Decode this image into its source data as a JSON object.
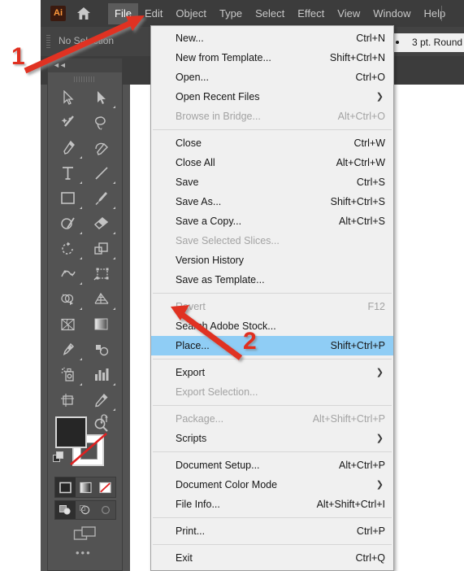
{
  "app": {
    "name": "Adobe Illustrator",
    "logo_text": "Ai",
    "home_icon": "home-icon"
  },
  "menubar": {
    "items": [
      {
        "label": "File",
        "active": true
      },
      {
        "label": "Edit",
        "active": false
      },
      {
        "label": "Object",
        "active": false
      },
      {
        "label": "Type",
        "active": false
      },
      {
        "label": "Select",
        "active": false
      },
      {
        "label": "Effect",
        "active": false
      },
      {
        "label": "View",
        "active": false
      },
      {
        "label": "Window",
        "active": false
      },
      {
        "label": "Help",
        "active": false
      }
    ]
  },
  "controlbar": {
    "selection_status": "No Selection",
    "brush_label": "3 pt. Round"
  },
  "toolpanel": {
    "collapse_icon": "double-chevron-left-icon",
    "more_tools": "•••",
    "tools": [
      {
        "name": "selection-tool",
        "corner": false
      },
      {
        "name": "direct-selection-tool",
        "corner": true
      },
      {
        "name": "magic-wand-tool",
        "corner": false
      },
      {
        "name": "lasso-tool",
        "corner": false
      },
      {
        "name": "pen-tool",
        "corner": true
      },
      {
        "name": "curvature-tool",
        "corner": false
      },
      {
        "name": "type-tool",
        "corner": true
      },
      {
        "name": "line-segment-tool",
        "corner": true
      },
      {
        "name": "rectangle-tool",
        "corner": true
      },
      {
        "name": "paintbrush-tool",
        "corner": true
      },
      {
        "name": "shaper-tool",
        "corner": true
      },
      {
        "name": "eraser-tool",
        "corner": true
      },
      {
        "name": "rotate-tool",
        "corner": true
      },
      {
        "name": "scale-tool",
        "corner": true
      },
      {
        "name": "width-tool",
        "corner": true
      },
      {
        "name": "free-transform-tool",
        "corner": false
      },
      {
        "name": "shape-builder-tool",
        "corner": true
      },
      {
        "name": "perspective-grid-tool",
        "corner": true
      },
      {
        "name": "mesh-tool",
        "corner": false
      },
      {
        "name": "gradient-tool",
        "corner": false
      },
      {
        "name": "eyedropper-tool",
        "corner": true
      },
      {
        "name": "blend-tool",
        "corner": false
      },
      {
        "name": "symbol-sprayer-tool",
        "corner": true
      },
      {
        "name": "column-graph-tool",
        "corner": true
      },
      {
        "name": "artboard-tool",
        "corner": false
      },
      {
        "name": "slice-tool",
        "corner": true
      },
      {
        "name": "hand-tool",
        "corner": true
      },
      {
        "name": "zoom-tool",
        "corner": false
      }
    ],
    "color_controls": {
      "fill": "#262626",
      "stroke": "#ffffff",
      "none_slash": "#e02020",
      "swap_icon": "swap-fill-stroke-icon",
      "default_icon": "default-fill-stroke-icon"
    },
    "fill_modes": [
      {
        "name": "color-mode",
        "selected": true
      },
      {
        "name": "gradient-mode",
        "selected": false
      },
      {
        "name": "none-mode",
        "selected": false
      }
    ],
    "draw_modes": [
      {
        "name": "draw-normal-mode",
        "selected": true
      },
      {
        "name": "draw-behind-mode",
        "selected": false
      },
      {
        "name": "draw-inside-mode",
        "selected": false
      }
    ],
    "screen_mode": "change-screen-mode-icon"
  },
  "file_menu": {
    "items": [
      {
        "type": "item",
        "label": "New...",
        "accel": "Ctrl+N",
        "disabled": false,
        "submenu": false,
        "highlight": false
      },
      {
        "type": "item",
        "label": "New from Template...",
        "accel": "Shift+Ctrl+N",
        "disabled": false,
        "submenu": false,
        "highlight": false
      },
      {
        "type": "item",
        "label": "Open...",
        "accel": "Ctrl+O",
        "disabled": false,
        "submenu": false,
        "highlight": false
      },
      {
        "type": "item",
        "label": "Open Recent Files",
        "accel": "",
        "disabled": false,
        "submenu": true,
        "highlight": false
      },
      {
        "type": "item",
        "label": "Browse in Bridge...",
        "accel": "Alt+Ctrl+O",
        "disabled": true,
        "submenu": false,
        "highlight": false
      },
      {
        "type": "sep"
      },
      {
        "type": "item",
        "label": "Close",
        "accel": "Ctrl+W",
        "disabled": false,
        "submenu": false,
        "highlight": false
      },
      {
        "type": "item",
        "label": "Close All",
        "accel": "Alt+Ctrl+W",
        "disabled": false,
        "submenu": false,
        "highlight": false
      },
      {
        "type": "item",
        "label": "Save",
        "accel": "Ctrl+S",
        "disabled": false,
        "submenu": false,
        "highlight": false
      },
      {
        "type": "item",
        "label": "Save As...",
        "accel": "Shift+Ctrl+S",
        "disabled": false,
        "submenu": false,
        "highlight": false
      },
      {
        "type": "item",
        "label": "Save a Copy...",
        "accel": "Alt+Ctrl+S",
        "disabled": false,
        "submenu": false,
        "highlight": false
      },
      {
        "type": "item",
        "label": "Save Selected Slices...",
        "accel": "",
        "disabled": true,
        "submenu": false,
        "highlight": false
      },
      {
        "type": "item",
        "label": "Version History",
        "accel": "",
        "disabled": false,
        "submenu": false,
        "highlight": false
      },
      {
        "type": "item",
        "label": "Save as Template...",
        "accel": "",
        "disabled": false,
        "submenu": false,
        "highlight": false
      },
      {
        "type": "sep"
      },
      {
        "type": "item",
        "label": "Revert",
        "accel": "F12",
        "disabled": true,
        "submenu": false,
        "highlight": false
      },
      {
        "type": "item",
        "label": "Search Adobe Stock...",
        "accel": "",
        "disabled": false,
        "submenu": false,
        "highlight": false
      },
      {
        "type": "item",
        "label": "Place...",
        "accel": "Shift+Ctrl+P",
        "disabled": false,
        "submenu": false,
        "highlight": true
      },
      {
        "type": "sep"
      },
      {
        "type": "item",
        "label": "Export",
        "accel": "",
        "disabled": false,
        "submenu": true,
        "highlight": false
      },
      {
        "type": "item",
        "label": "Export Selection...",
        "accel": "",
        "disabled": true,
        "submenu": false,
        "highlight": false
      },
      {
        "type": "sep"
      },
      {
        "type": "item",
        "label": "Package...",
        "accel": "Alt+Shift+Ctrl+P",
        "disabled": true,
        "submenu": false,
        "highlight": false
      },
      {
        "type": "item",
        "label": "Scripts",
        "accel": "",
        "disabled": false,
        "submenu": true,
        "highlight": false
      },
      {
        "type": "sep"
      },
      {
        "type": "item",
        "label": "Document Setup...",
        "accel": "Alt+Ctrl+P",
        "disabled": false,
        "submenu": false,
        "highlight": false
      },
      {
        "type": "item",
        "label": "Document Color Mode",
        "accel": "",
        "disabled": false,
        "submenu": true,
        "highlight": false
      },
      {
        "type": "item",
        "label": "File Info...",
        "accel": "Alt+Shift+Ctrl+I",
        "disabled": false,
        "submenu": false,
        "highlight": false
      },
      {
        "type": "sep"
      },
      {
        "type": "item",
        "label": "Print...",
        "accel": "Ctrl+P",
        "disabled": false,
        "submenu": false,
        "highlight": false
      },
      {
        "type": "sep"
      },
      {
        "type": "item",
        "label": "Exit",
        "accel": "Ctrl+Q",
        "disabled": false,
        "submenu": false,
        "highlight": false
      }
    ]
  },
  "annotations": {
    "color": "#e03020",
    "markers": [
      {
        "label": "1",
        "target": "file-menu-title"
      },
      {
        "label": "2",
        "target": "place-menu-item"
      }
    ]
  }
}
